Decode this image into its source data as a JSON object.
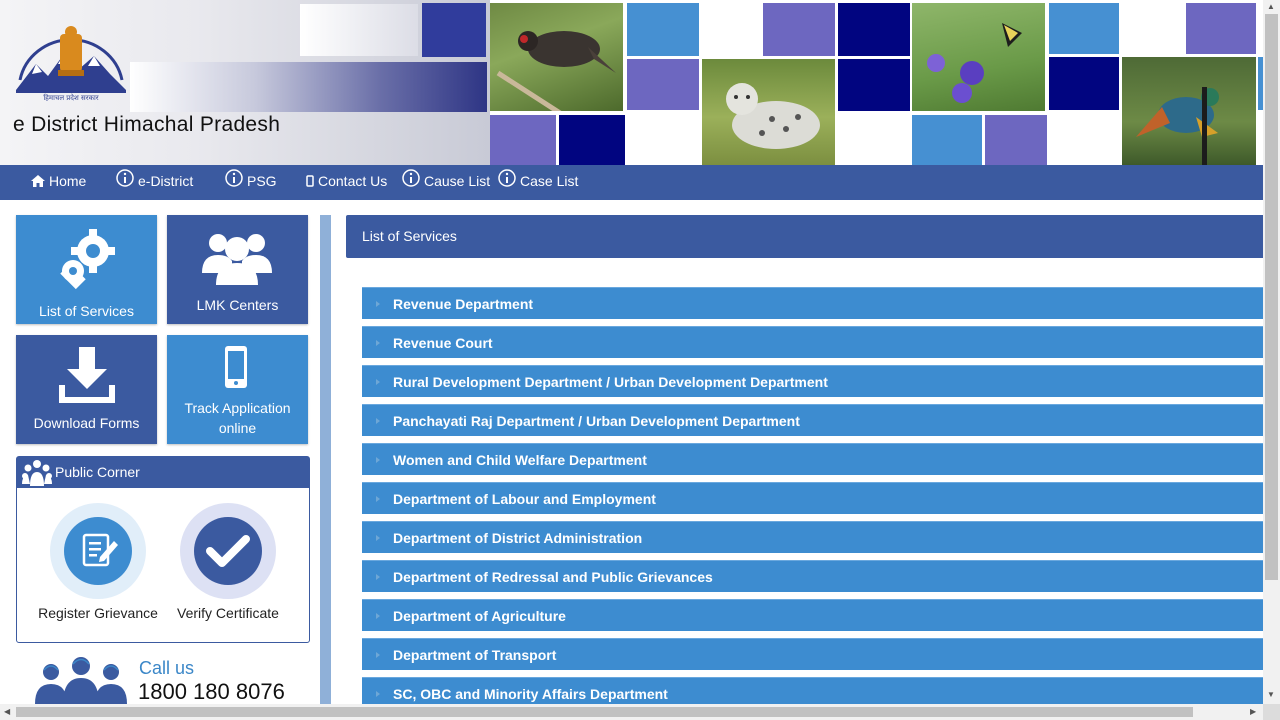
{
  "header": {
    "title": "e District Himachal Pradesh",
    "emblem_caption": "हिमाचल प्रदेश सरकार"
  },
  "nav": [
    {
      "label": "Home",
      "icon": "home-icon"
    },
    {
      "label": "e-District",
      "icon": "info-icon"
    },
    {
      "label": "PSG",
      "icon": "info-icon"
    },
    {
      "label": "Contact Us",
      "icon": "mobile-icon"
    },
    {
      "label": "Cause List",
      "icon": "info-icon"
    },
    {
      "label": "Case List",
      "icon": "info-icon"
    }
  ],
  "tiles": [
    {
      "label": "List of Services",
      "icon": "gears-icon"
    },
    {
      "label": "LMK Centers",
      "icon": "users-icon"
    },
    {
      "label": "Download Forms",
      "icon": "download-icon"
    },
    {
      "label_line1": "Track Application",
      "label_line2": "online",
      "icon": "mobile-icon"
    }
  ],
  "public_corner": {
    "title": "Public Corner",
    "items": [
      {
        "label": "Register Grievance",
        "icon": "edit-form-icon"
      },
      {
        "label": "Verify Certificate",
        "icon": "check-icon"
      }
    ]
  },
  "call": {
    "label": "Call us",
    "number": "1800 180 8076"
  },
  "main": {
    "heading": "List of Services",
    "departments": [
      "Revenue Department",
      "Revenue Court",
      "Rural Development Department / Urban Development Department",
      "Panchayati Raj Department / Urban Development Department",
      "Women and Child Welfare Department",
      "Department of Labour and Employment",
      "Department of District Administration",
      "Department of Redressal and Public Grievances",
      "Department of Agriculture",
      "Department of Transport",
      "SC, OBC and Minority Affairs Department"
    ]
  },
  "colors": {
    "nav_bg": "#3b5aa0",
    "tile_dark": "#3b5aa0",
    "tile_light": "#3d8cd0",
    "accent_link": "#3b87c8"
  }
}
